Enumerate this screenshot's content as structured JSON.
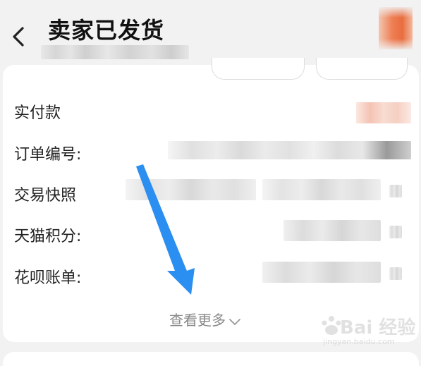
{
  "header": {
    "title": "卖家已发货",
    "back_icon": "chevron-left-icon"
  },
  "order": {
    "rows": [
      {
        "label": "实付款"
      },
      {
        "label": "订单编号:"
      },
      {
        "label": "交易快照"
      },
      {
        "label": "天猫积分:"
      },
      {
        "label": "花呗账单:"
      }
    ],
    "more_label": "查看更多",
    "more_icon": "chevron-down-icon"
  },
  "annotation": {
    "arrow_color": "#2a8ff0"
  },
  "watermark": {
    "text": "Bai 经验",
    "sub": "jingyan.baidu.com"
  },
  "colors": {
    "background": "#f2f2f2",
    "card": "#ffffff",
    "text": "#222222",
    "muted": "#888888"
  }
}
